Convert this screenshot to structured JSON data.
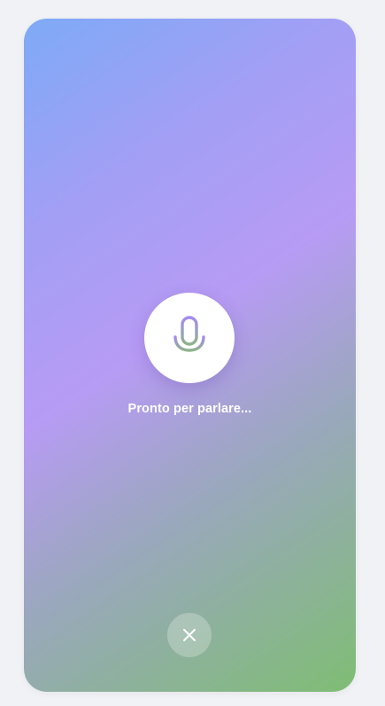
{
  "voice_input": {
    "status_text": "Pronto per parlare...",
    "mic_icon": "microphone-icon",
    "close_icon": "close-icon"
  },
  "colors": {
    "gradient_top_left": "#7eaaf6",
    "gradient_middle": "#b79bf4",
    "gradient_bottom_right": "#7fbd74",
    "mic_top": "#a48cf0",
    "mic_bottom": "#8fb38b",
    "text": "#ffffff"
  }
}
